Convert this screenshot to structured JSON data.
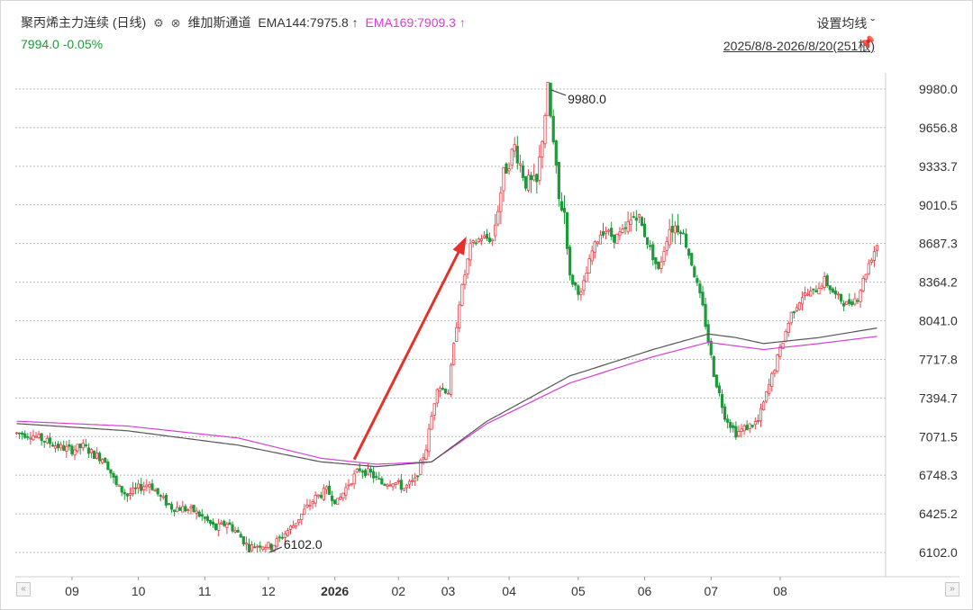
{
  "header": {
    "title": "聚丙烯主力连续 (日线)",
    "gear_icon": "gear-icon",
    "close_icon": "close-circle-icon",
    "indicator": "维加斯通道",
    "ema144_label": "EMA144:7975.8 ↑",
    "ema169_label": "EMA169:7909.3 ↑",
    "last_price": "7994.0",
    "change": "-0.05%",
    "settings_label": "设置均线 ˇ",
    "range_label": "2025/8/8-2026/8/20(251根)"
  },
  "colors": {
    "up": "#e8424a",
    "down": "#1d9a3a",
    "ema144": "#555555",
    "ema169": "#d33fd3",
    "arrow": "#e8302a"
  },
  "chart_data": {
    "type": "candlestick",
    "title": "聚丙烯主力连续 (日线)",
    "y_ticks": [
      "9980.0",
      "9656.8",
      "9333.7",
      "9010.5",
      "8687.3",
      "8364.2",
      "8041.0",
      "7717.8",
      "7394.7",
      "7071.5",
      "6748.3",
      "6425.2",
      "6102.0"
    ],
    "ylim": [
      6102.0,
      9980.0
    ],
    "x_ticks": [
      "09",
      "10",
      "11",
      "12",
      "2026",
      "02",
      "03",
      "04",
      "05",
      "06",
      "07",
      "08"
    ],
    "annotations": [
      {
        "text": "9980.0",
        "note": "high"
      },
      {
        "text": "6102.0",
        "note": "low"
      }
    ],
    "price_path": [
      [
        0,
        7100
      ],
      [
        5,
        7090
      ],
      [
        10,
        7040
      ],
      [
        16,
        6980
      ],
      [
        20,
        6960
      ],
      [
        24,
        6990
      ],
      [
        28,
        6920
      ],
      [
        32,
        6880
      ],
      [
        36,
        6660
      ],
      [
        40,
        6580
      ],
      [
        44,
        6640
      ],
      [
        48,
        6680
      ],
      [
        52,
        6560
      ],
      [
        56,
        6480
      ],
      [
        60,
        6470
      ],
      [
        64,
        6450
      ],
      [
        68,
        6380
      ],
      [
        72,
        6300
      ],
      [
        76,
        6350
      ],
      [
        80,
        6260
      ],
      [
        84,
        6140
      ],
      [
        88,
        6170
      ],
      [
        92,
        6150
      ],
      [
        96,
        6240
      ],
      [
        100,
        6330
      ],
      [
        104,
        6450
      ],
      [
        108,
        6560
      ],
      [
        112,
        6620
      ],
      [
        116,
        6520
      ],
      [
        120,
        6680
      ],
      [
        124,
        6800
      ],
      [
        128,
        6760
      ],
      [
        132,
        6680
      ],
      [
        136,
        6700
      ],
      [
        140,
        6640
      ],
      [
        144,
        6700
      ],
      [
        148,
        6980
      ],
      [
        152,
        7500
      ],
      [
        156,
        7450
      ],
      [
        160,
        8200
      ],
      [
        164,
        8660
      ],
      [
        168,
        8740
      ],
      [
        172,
        8720
      ],
      [
        176,
        9260
      ],
      [
        180,
        9500
      ],
      [
        184,
        9200
      ],
      [
        188,
        9180
      ],
      [
        192,
        9980
      ],
      [
        196,
        9050
      ],
      [
        198,
        8950
      ],
      [
        200,
        8400
      ],
      [
        204,
        8260
      ],
      [
        208,
        8620
      ],
      [
        212,
        8820
      ],
      [
        216,
        8730
      ],
      [
        220,
        8800
      ],
      [
        224,
        8950
      ],
      [
        228,
        8700
      ],
      [
        232,
        8460
      ],
      [
        236,
        8820
      ],
      [
        240,
        8840
      ],
      [
        244,
        8520
      ],
      [
        248,
        8150
      ],
      [
        252,
        7600
      ],
      [
        256,
        7250
      ],
      [
        260,
        7100
      ],
      [
        264,
        7150
      ],
      [
        268,
        7200
      ],
      [
        272,
        7500
      ],
      [
        276,
        7800
      ],
      [
        280,
        8100
      ],
      [
        284,
        8250
      ],
      [
        288,
        8280
      ],
      [
        292,
        8380
      ],
      [
        296,
        8250
      ],
      [
        300,
        8180
      ],
      [
        304,
        8240
      ],
      [
        308,
        8520
      ],
      [
        311,
        8680
      ]
    ],
    "ema144": [
      [
        0,
        7180
      ],
      [
        40,
        7120
      ],
      [
        80,
        7000
      ],
      [
        110,
        6860
      ],
      [
        130,
        6820
      ],
      [
        150,
        6860
      ],
      [
        170,
        7200
      ],
      [
        200,
        7580
      ],
      [
        230,
        7800
      ],
      [
        250,
        7930
      ],
      [
        260,
        7900
      ],
      [
        270,
        7850
      ],
      [
        290,
        7900
      ],
      [
        311,
        7980
      ]
    ],
    "ema169": [
      [
        0,
        7200
      ],
      [
        40,
        7160
      ],
      [
        80,
        7060
      ],
      [
        110,
        6890
      ],
      [
        130,
        6840
      ],
      [
        150,
        6860
      ],
      [
        170,
        7180
      ],
      [
        200,
        7520
      ],
      [
        230,
        7740
      ],
      [
        250,
        7860
      ],
      [
        260,
        7830
      ],
      [
        270,
        7800
      ],
      [
        290,
        7850
      ],
      [
        311,
        7910
      ]
    ]
  }
}
